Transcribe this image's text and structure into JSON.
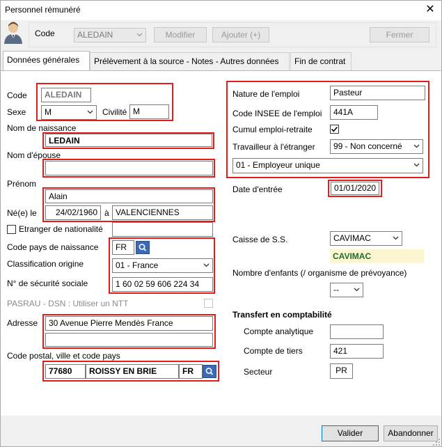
{
  "window": {
    "title": "Personnel rémunéré"
  },
  "toolbar": {
    "code_label": "Code",
    "code_value": "ALEDAIN",
    "modifier": "Modifier",
    "ajouter": "Ajouter (+)",
    "fermer": "Fermer"
  },
  "tabs": [
    {
      "label": "Données générales"
    },
    {
      "label": "Prélèvement à la source - Notes - Autres données"
    },
    {
      "label": "Fin de contrat"
    }
  ],
  "left": {
    "code_label": "Code",
    "code_value": "ALEDAIN",
    "sexe_label": "Sexe",
    "sexe_value": "M",
    "civilite_label": "Civilité",
    "civilite_value": "M",
    "nom_naissance_label": "Nom de naissance",
    "nom_naissance_value": "LEDAIN",
    "nom_epouse_label": "Nom d'épouse",
    "nom_epouse_value": "",
    "prenom_label": "Prénom",
    "prenom_value": "Alain",
    "ne_le_label": "Né(e) le",
    "ne_le_value": "24/02/1960",
    "a_label": "à",
    "lieu_value": "VALENCIENNES",
    "etranger_label": "Etranger de nationalité",
    "etranger_value": "",
    "code_pays_label": "Code pays de naissance",
    "code_pays_value": "FR",
    "classification_label": "Classification origine",
    "classification_value": "01 - France",
    "nss_label": "N° de sécurité sociale",
    "nss_value": "1 60 02 59 606 224 34",
    "pasrau_label": "PASRAU - DSN : Utiliser un NTT",
    "adresse_label": "Adresse",
    "adresse1_value": "30 Avenue Pierre Mendès France",
    "adresse2_value": "",
    "cp_label": "Code postal, ville et code pays",
    "cp_value": "77680",
    "ville_value": "ROISSY EN BRIE",
    "pays_value": "FR"
  },
  "right": {
    "nature_label": "Nature de l'emploi",
    "nature_value": "Pasteur",
    "insee_label": "Code INSEE de l'emploi",
    "insee_value": "441A",
    "cumul_label": "Cumul emploi-retraite",
    "cumul_checked": true,
    "travailleur_label": "Travailleur à l'étranger",
    "travailleur_value": "99 - Non concerné",
    "employeur_value": "01 - Employeur unique",
    "date_entree_label": "Date d'entrée",
    "date_entree_value": "01/01/2020",
    "caisse_label": "Caisse de S.S.",
    "caisse_value": "CAVIMAC",
    "caisse_name": "CAVIMAC",
    "enfants_label": "Nombre d'enfants (/ organisme de prévoyance)",
    "enfants_value": "--",
    "transfert_title": "Transfert en comptabilité",
    "compte_analytique_label": "Compte analytique",
    "compte_analytique_value": "",
    "compte_tiers_label": "Compte de tiers",
    "compte_tiers_value": "421",
    "secteur_label": "Secteur",
    "secteur_value": "PR"
  },
  "footer": {
    "valider": "Valider",
    "abandonner": "Abandonner"
  },
  "colors": {
    "highlight_border": "#e21b1b",
    "caisse_bg": "#fbf6cf",
    "caisse_text": "#1b6f2a",
    "search_button": "#3c6bb5"
  }
}
